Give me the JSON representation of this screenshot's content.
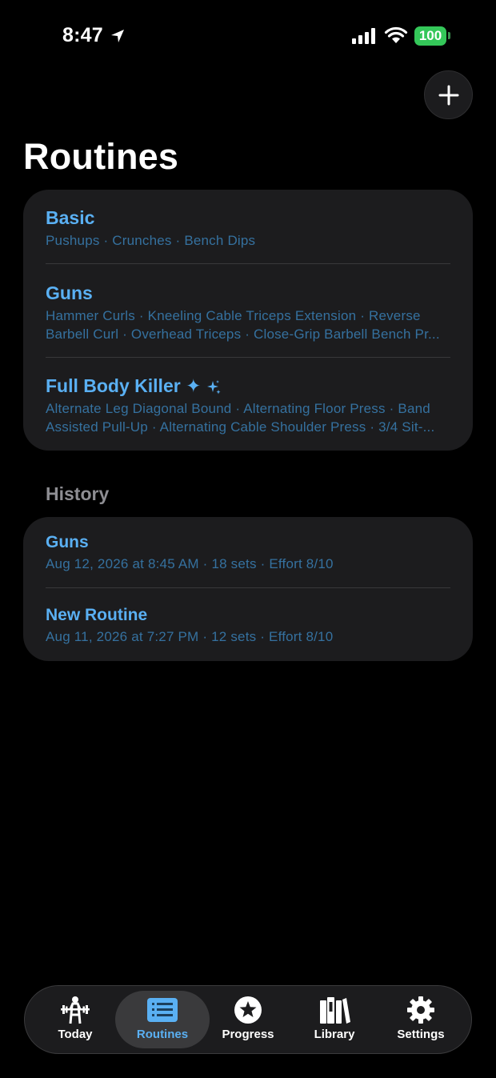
{
  "status": {
    "time": "8:47",
    "battery": "100"
  },
  "header": {
    "title": "Routines"
  },
  "routines": [
    {
      "name": "Basic",
      "lines": [
        "Pushups · Crunches · Bench Dips"
      ]
    },
    {
      "name": "Guns",
      "lines": [
        "Hammer Curls · Kneeling Cable Triceps Extension · Reverse",
        "Barbell Curl · Overhead Triceps · Close-Grip Barbell Bench Pr..."
      ]
    },
    {
      "name": "Full Body Killer ✦",
      "lines": [
        "Alternate Leg Diagonal Bound · Alternating Floor Press · Band",
        "Assisted Pull-Up · Alternating Cable Shoulder Press · 3/4 Sit-..."
      ]
    }
  ],
  "history": {
    "header": "History",
    "items": [
      {
        "name": "Guns",
        "details": "Aug 12, 2026 at 8:45 AM  · 18 sets  · Effort 8/10"
      },
      {
        "name": "New Routine",
        "details": "Aug 11, 2026 at 7:27 PM  · 12 sets  · Effort 8/10"
      }
    ]
  },
  "tabs": [
    {
      "label": "Today",
      "icon": "weightlifter-icon"
    },
    {
      "label": "Routines",
      "icon": "list-icon",
      "active": true
    },
    {
      "label": "Progress",
      "icon": "star-circle-icon"
    },
    {
      "label": "Library",
      "icon": "books-icon"
    },
    {
      "label": "Settings",
      "icon": "gear-icon"
    }
  ],
  "colors": {
    "accent": "#5ab0f3",
    "subtitle": "#35719f",
    "card": "#1c1c1e",
    "battery": "#34c759"
  }
}
